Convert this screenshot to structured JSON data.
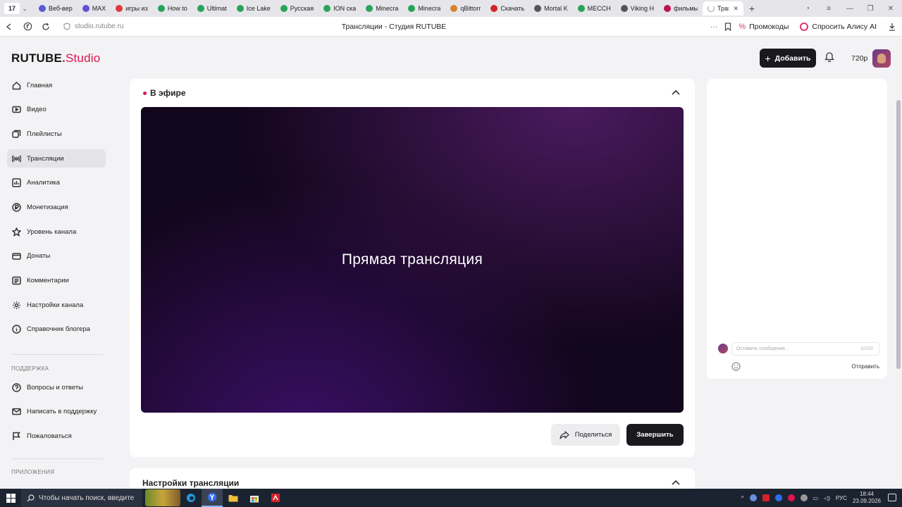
{
  "browser": {
    "tab_counter": "17",
    "tabs": [
      {
        "label": "Веб-вер",
        "color": "#5b5bd6"
      },
      {
        "label": "MAX",
        "color": "#6a4ad8"
      },
      {
        "label": "игры из",
        "color": "#e03a3a"
      },
      {
        "label": "How to",
        "color": "#2aa35a"
      },
      {
        "label": "Ultimat",
        "color": "#2aa35a"
      },
      {
        "label": "Ice Lake",
        "color": "#2aa35a"
      },
      {
        "label": "Русская",
        "color": "#2aa35a"
      },
      {
        "label": "ION ска",
        "color": "#2aa35a"
      },
      {
        "label": "Minecra",
        "color": "#2aa35a"
      },
      {
        "label": "Minecra",
        "color": "#2aa35a"
      },
      {
        "label": "qBittorr",
        "color": "#d9822b"
      },
      {
        "label": "Скачать",
        "color": "#d3242b"
      },
      {
        "label": "Mortal K",
        "color": "#555555"
      },
      {
        "label": "MECCH",
        "color": "#2aa35a"
      },
      {
        "label": "Viking H",
        "color": "#555555"
      },
      {
        "label": "фильмы",
        "color": "#c0134a"
      }
    ],
    "active_tab": "Тран",
    "url": "studio.rutube.ru",
    "page_title": "Трансляции - Студия RUTUBE",
    "promo_label": "Промокоды",
    "alice_label": "Спросить Алису AI"
  },
  "studio": {
    "logo_main": "RUTUBE",
    "logo_dot": ".",
    "logo_sub": "Studio",
    "add_button": "Добавить",
    "quality": "720p"
  },
  "sidebar": {
    "items": [
      {
        "label": "Главная",
        "icon": "home-icon"
      },
      {
        "label": "Видео",
        "icon": "video-icon"
      },
      {
        "label": "Плейлисты",
        "icon": "playlist-icon"
      },
      {
        "label": "Трансляции",
        "icon": "broadcast-icon",
        "active": true
      },
      {
        "label": "Аналитика",
        "icon": "analytics-icon"
      },
      {
        "label": "Монетизация",
        "icon": "monetization-icon"
      },
      {
        "label": "Уровень канала",
        "icon": "star-icon"
      },
      {
        "label": "Донаты",
        "icon": "donate-icon"
      },
      {
        "label": "Комментарии",
        "icon": "comment-icon"
      },
      {
        "label": "Настройки канала",
        "icon": "gear-icon"
      },
      {
        "label": "Справочник блогера",
        "icon": "info-icon"
      }
    ],
    "support_heading": "ПОДДЕРЖКА",
    "support_items": [
      {
        "label": "Вопросы и ответы",
        "icon": "help-icon"
      },
      {
        "label": "Написать в поддержку",
        "icon": "mail-icon"
      },
      {
        "label": "Пожаловаться",
        "icon": "flag-icon"
      }
    ],
    "apps_heading": "ПРИЛОЖЕНИЯ"
  },
  "live": {
    "title": "В эфире",
    "player_text": "Прямая трансляция",
    "share_button": "Поделиться",
    "end_button": "Завершить"
  },
  "settings": {
    "title": "Настройки трансляции"
  },
  "chat": {
    "placeholder": "Оставить сообщение...",
    "counter": "0/200",
    "send_button": "Отправить"
  },
  "taskbar": {
    "search_placeholder": "Чтобы начать поиск, введите",
    "language": "РУС",
    "time": "18:44",
    "date": "23.09.2026"
  },
  "colors": {
    "accent": "#e0154e",
    "dark_button": "#1a1a1e"
  }
}
